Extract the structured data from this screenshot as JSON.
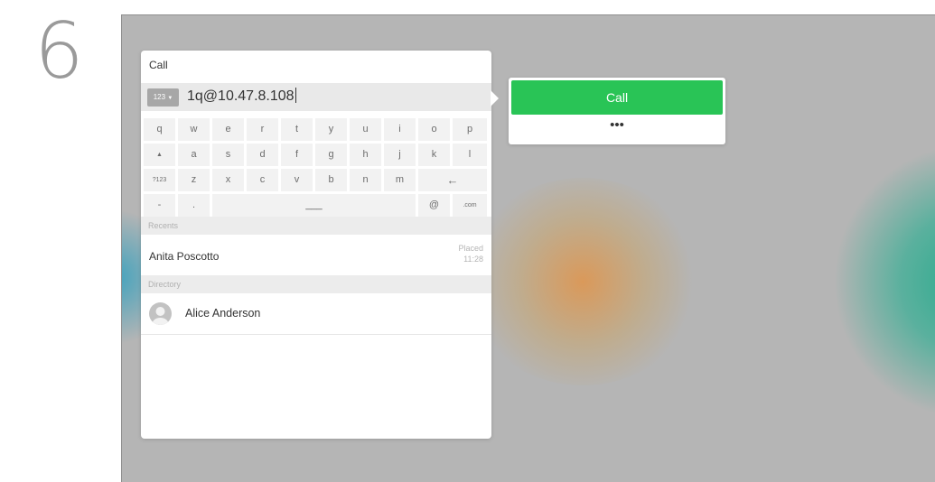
{
  "step_number": "6",
  "dial_panel": {
    "title": "Call",
    "mode_label": "123",
    "input_value": "1q@10.47.8.108",
    "keyboard": {
      "row1": [
        "q",
        "w",
        "e",
        "r",
        "t",
        "y",
        "u",
        "i",
        "o",
        "p"
      ],
      "row2": [
        "▲",
        "a",
        "s",
        "d",
        "f",
        "g",
        "h",
        "j",
        "k",
        "l"
      ],
      "row3": [
        "?123",
        "z",
        "x",
        "c",
        "v",
        "b",
        "n",
        "m",
        "←"
      ],
      "row4": [
        "-",
        ".",
        "___",
        "@",
        ".com"
      ]
    },
    "recents": {
      "heading": "Recents",
      "items": [
        {
          "name": "Anita Poscotto",
          "status": "Placed",
          "time": "11:28"
        }
      ]
    },
    "directory": {
      "heading": "Directory",
      "items": [
        {
          "name": "Alice Anderson"
        }
      ]
    }
  },
  "call_actions": {
    "call_label": "Call",
    "more_label": "•••"
  },
  "colors": {
    "call_green": "#29c456",
    "screen_bg": "#b5b5b5",
    "step_number": "#9a9a9a"
  }
}
